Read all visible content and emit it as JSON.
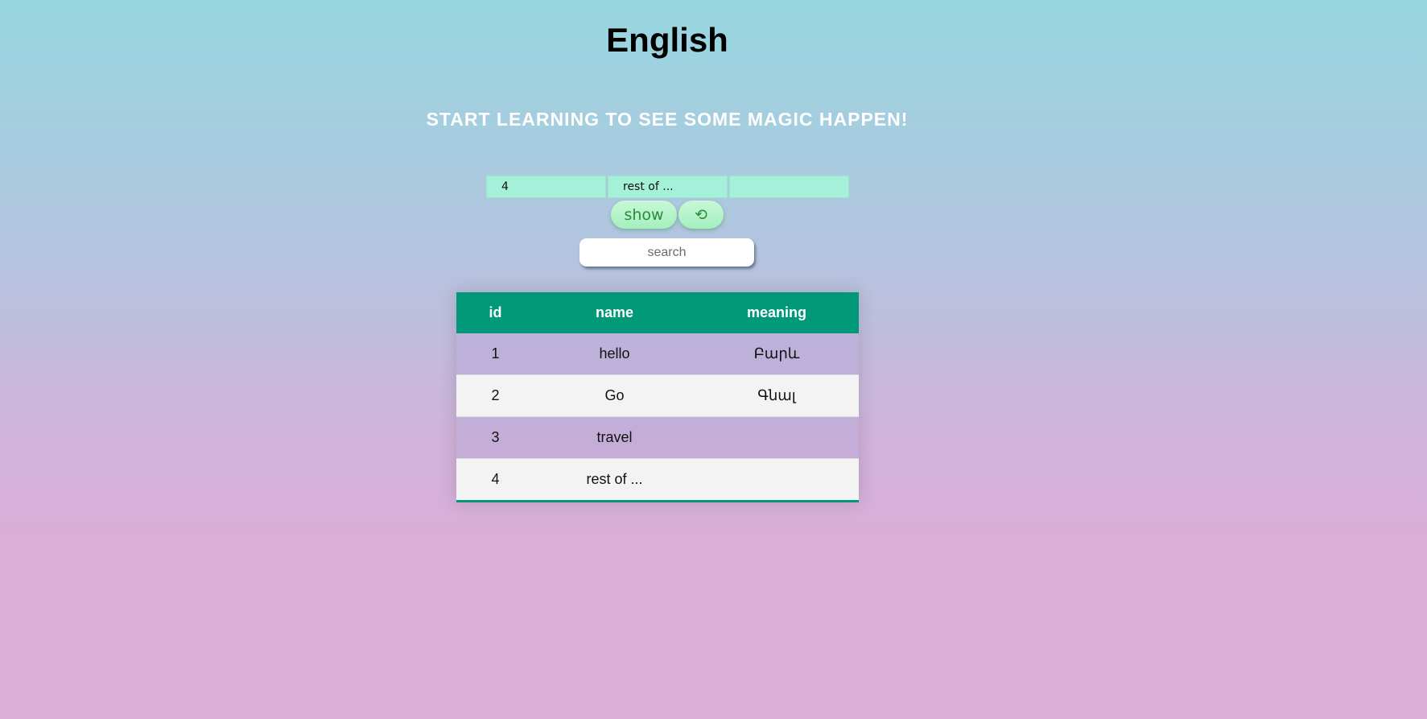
{
  "header": {
    "title": "English",
    "subtitle": "START LEARNING TO SEE SOME MAGIC HAPPEN!"
  },
  "form": {
    "id_value": "4",
    "name_value": "rest of ...",
    "meaning_value": "",
    "show_label": "show",
    "reset_icon": "refresh-icon",
    "reset_glyph": "⟲"
  },
  "search": {
    "placeholder": "search",
    "value": ""
  },
  "table": {
    "headers": {
      "id": "id",
      "name": "name",
      "meaning": "meaning"
    },
    "rows": [
      {
        "id": "1",
        "name": "hello",
        "meaning": "Բարև"
      },
      {
        "id": "2",
        "name": "Go",
        "meaning": "Գնալ"
      },
      {
        "id": "3",
        "name": "travel",
        "meaning": ""
      },
      {
        "id": "4",
        "name": "rest of ...",
        "meaning": ""
      }
    ]
  },
  "colors": {
    "table_header": "#009879",
    "input_bg": "#a5f0d9",
    "button_bg": "#a4efc0",
    "button_text": "#2b8a3e"
  }
}
